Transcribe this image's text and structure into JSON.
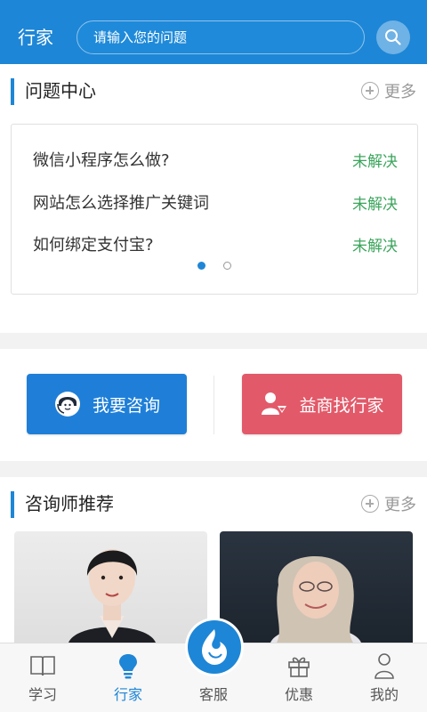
{
  "header": {
    "title": "行家",
    "search_placeholder": "请输入您的问题",
    "search_icon": "search-icon"
  },
  "question_center": {
    "title": "问题中心",
    "more_label": "更多",
    "items": [
      {
        "text": "微信小程序怎么做?",
        "status": "未解决"
      },
      {
        "text": "网站怎么选择推广关键词",
        "status": "未解决"
      },
      {
        "text": "如何绑定支付宝?",
        "status": "未解决"
      }
    ],
    "pagination": {
      "current": 1,
      "total": 2
    }
  },
  "actions": {
    "consult_label": "我要咨询",
    "find_expert_label": "益商找行家"
  },
  "consultants": {
    "title": "咨询师推荐",
    "more_label": "更多"
  },
  "bottom_nav": {
    "items": [
      {
        "label": "学习",
        "icon": "book-icon",
        "active": false
      },
      {
        "label": "行家",
        "icon": "lightbulb-icon",
        "active": true
      },
      {
        "label": "客服",
        "icon": "customer-service-icon",
        "active": false
      },
      {
        "label": "优惠",
        "icon": "gift-icon",
        "active": false
      },
      {
        "label": "我的",
        "icon": "user-icon",
        "active": false
      }
    ]
  },
  "colors": {
    "brand_blue": "#1e86d6",
    "status_green": "#3ba55c",
    "find_button_red": "#e25a6a"
  }
}
